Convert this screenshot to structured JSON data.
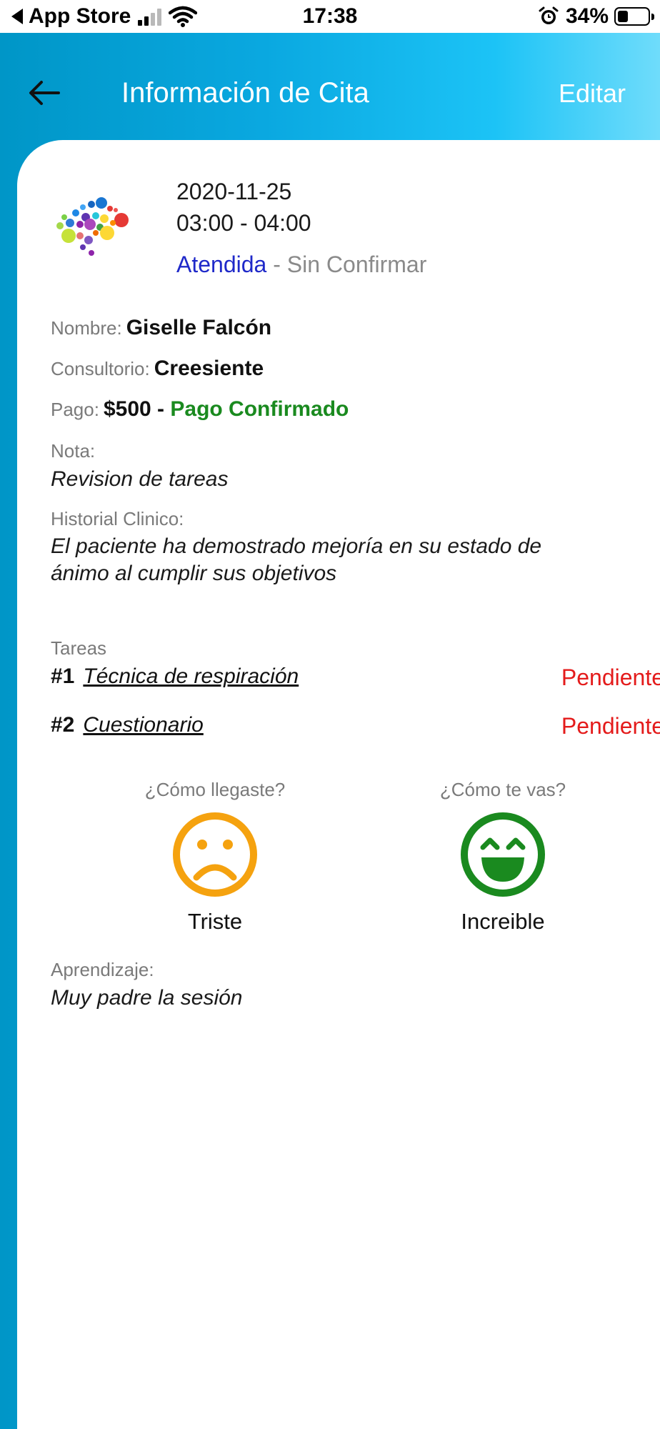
{
  "status_bar": {
    "back_app": "App Store",
    "time": "17:38",
    "battery": "34%",
    "battery_level": 0.34
  },
  "header": {
    "title": "Información de Cita",
    "edit_label": "Editar"
  },
  "appointment": {
    "date": "2020-11-25",
    "time_range": "03:00 - 04:00",
    "status": "Atendida",
    "status_separator": " - ",
    "confirmation": "Sin Confirmar"
  },
  "details": {
    "name_label": "Nombre:",
    "name_value": "Giselle Falcón",
    "office_label": "Consultorio:",
    "office_value": "Creesiente",
    "payment_label": "Pago:",
    "payment_amount": "$500",
    "payment_separator": " - ",
    "payment_status": "Pago Confirmado",
    "note_label": "Nota:",
    "note_value": "Revision de tareas",
    "history_label": "Historial Clinico:",
    "history_line1": "El paciente ha demostrado mejoría en su estado de",
    "history_line2": "ánimo al cumplir sus objetivos"
  },
  "tasks": {
    "label": "Tareas",
    "items": [
      {
        "number": "#1",
        "name": "Técnica de respiración",
        "status": "Pendiente"
      },
      {
        "number": "#2",
        "name": "Cuestionario",
        "status": "Pendiente"
      }
    ]
  },
  "mood": {
    "arrival_question": "¿Cómo llegaste?",
    "arrival_label": "Triste",
    "arrival_icon": "sad-face-icon",
    "arrival_color": "#f5a20f",
    "departure_question": "¿Cómo te vas?",
    "departure_label": "Increible",
    "departure_icon": "grinning-face-icon",
    "departure_color": "#1a8a1f"
  },
  "learning": {
    "label": "Aprendizaje:",
    "value": "Muy padre la sesión"
  }
}
